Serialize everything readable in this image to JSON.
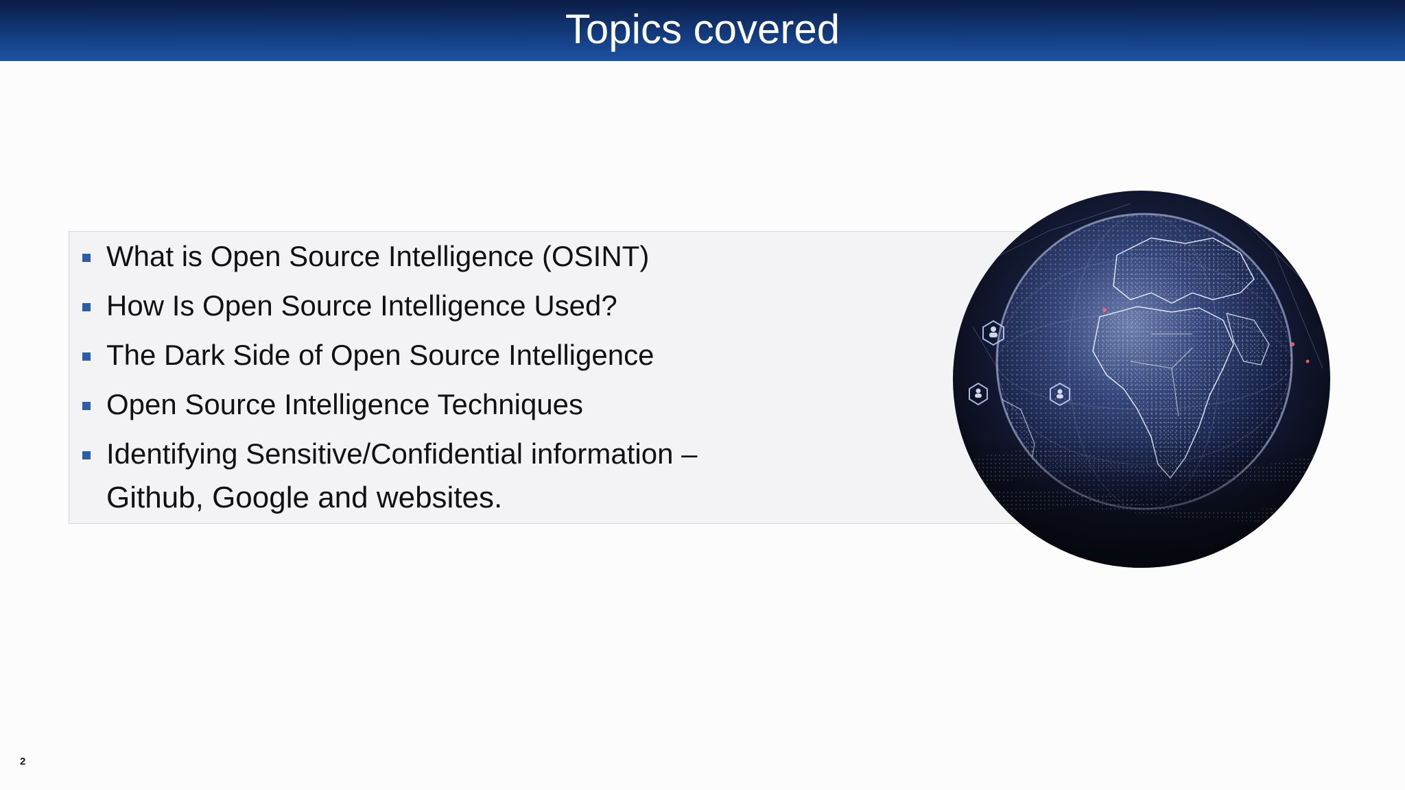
{
  "slide": {
    "title": "Topics covered",
    "bullets": [
      {
        "text": "What is Open Source Intelligence (OSINT)",
        "continuation": ""
      },
      {
        "text": "How Is Open Source Intelligence Used?",
        "continuation": ""
      },
      {
        "text": "The Dark Side of Open Source Intelligence",
        "continuation": ""
      },
      {
        "text": "Open Source Intelligence Techniques",
        "continuation": ""
      },
      {
        "text": "Identifying Sensitive/Confidential information –",
        "continuation": "Github, Google and websites."
      }
    ],
    "image": {
      "name": "globe-network-image"
    },
    "page_number": "2",
    "colors": {
      "title_bar_top": "#0a1d44",
      "title_bar_bottom": "#1c53a4",
      "bullet_marker": "#2c5ea8",
      "content_box": "#f3f2f5"
    }
  }
}
